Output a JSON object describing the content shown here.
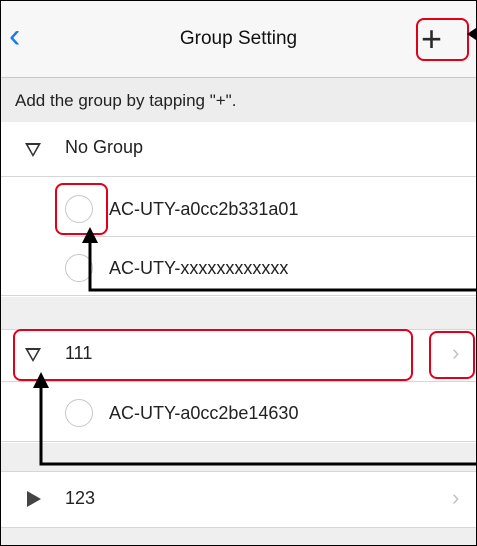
{
  "nav": {
    "back_icon": "chevron-left-icon",
    "title": "Group Setting",
    "add_icon": "plus-icon"
  },
  "banner": {
    "text": "Add the group by tapping \"+\"."
  },
  "groups": [
    {
      "name": "No Group",
      "expanded": true,
      "devices": [
        "AC-UTY-a0cc2b331a01",
        "AC-UTY-xxxxxxxxxxxx"
      ]
    },
    {
      "name": "111",
      "expanded": true,
      "devices": [
        "AC-UTY-a0cc2be14630"
      ]
    },
    {
      "name": "123",
      "expanded": false,
      "devices": []
    }
  ],
  "colors": {
    "accent": "#1478f0",
    "highlight": "#e0001a",
    "annotation": "#000000"
  }
}
